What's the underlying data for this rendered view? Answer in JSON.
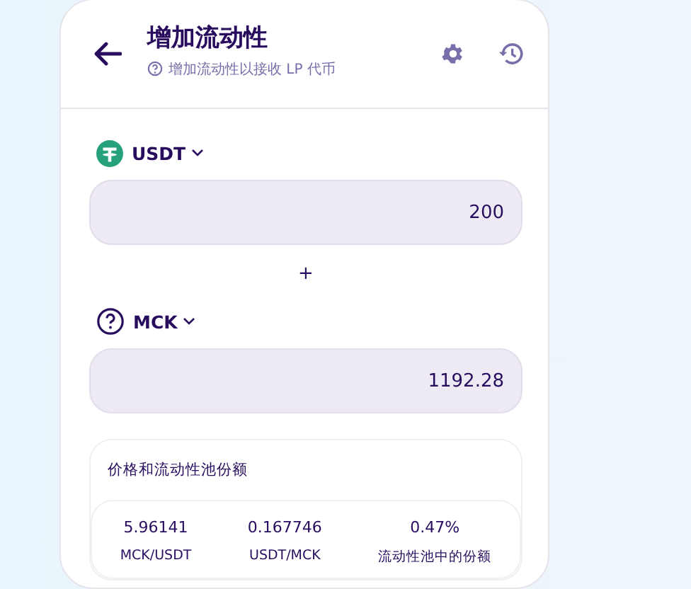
{
  "header": {
    "title": "增加流动性",
    "subtitle": "增加流动性以接收 LP 代币"
  },
  "tokens": [
    {
      "symbol": "USDT",
      "kind": "tether",
      "amount": "200"
    },
    {
      "symbol": "MCK",
      "kind": "unknown",
      "amount": "1192.28"
    }
  ],
  "separator": "+",
  "pool": {
    "title": "价格和流动性池份额",
    "stats": [
      {
        "value": "5.96141",
        "label": "MCK/USDT"
      },
      {
        "value": "0.167746",
        "label": "USDT/MCK"
      },
      {
        "value": "0.47%",
        "label": "流动性池中的份额"
      }
    ]
  }
}
